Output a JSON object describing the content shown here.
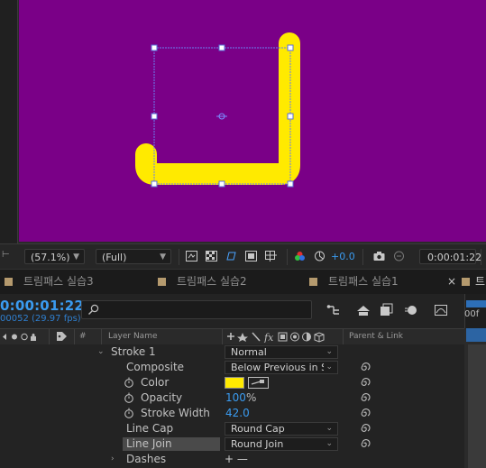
{
  "viewer": {
    "zoom": "(57.1%)",
    "resolution": "(Full)",
    "exposure": "+0.0",
    "current_time": "0:00:01:22",
    "canvas_color": "#7a0087",
    "stroke_color": "#ffea00"
  },
  "tabs": [
    {
      "label": "트림패스 실습3"
    },
    {
      "label": "트림패스 실습2"
    },
    {
      "label": "트림패스 실습1"
    }
  ],
  "tab_close": "×",
  "timeline": {
    "timecode": "0:00:01:22",
    "frames": "00052 (29.97 fps)",
    "search_placeholder": "",
    "ruler_label": "00f"
  },
  "columns": {
    "hash": "#",
    "layer_name": "Layer Name",
    "parent": "Parent & Link"
  },
  "properties": [
    {
      "name": "Stroke 1",
      "value": "Normal",
      "kind": "dropdown"
    },
    {
      "name": "Composite",
      "value": "Below Previous in Sa",
      "kind": "dropdown"
    },
    {
      "name": "Color",
      "value": "",
      "kind": "color"
    },
    {
      "name": "Opacity",
      "value": "100",
      "unit": "%",
      "kind": "number"
    },
    {
      "name": "Stroke Width",
      "value": "42.0",
      "kind": "number"
    },
    {
      "name": "Line Cap",
      "value": "Round Cap",
      "kind": "dropdown"
    },
    {
      "name": "Line Join",
      "value": "Round Join",
      "kind": "dropdown"
    },
    {
      "name": "Dashes",
      "value": "+ —",
      "kind": "buttons"
    }
  ],
  "icons": [
    "search-icon",
    "stopwatch-icon",
    "pickwhip-icon",
    "eyedropper-icon",
    "camera-icon",
    "chevron-down-icon"
  ]
}
